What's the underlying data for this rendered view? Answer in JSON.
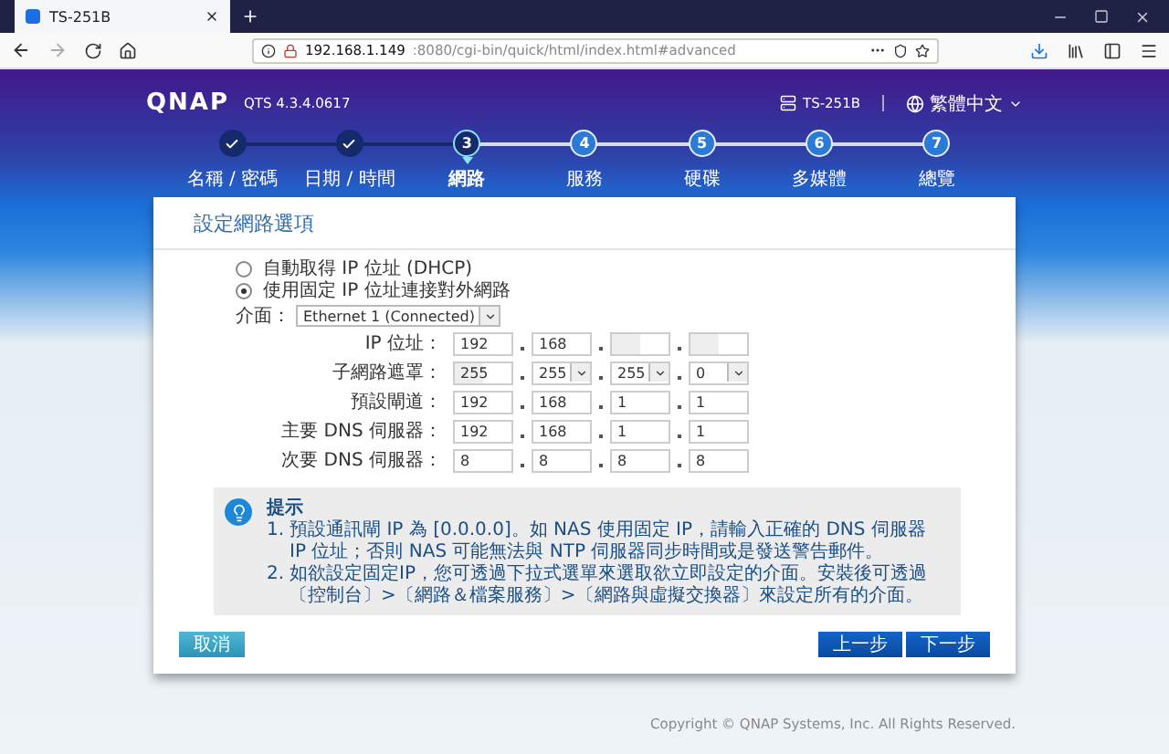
{
  "browser": {
    "tab_title": "TS-251B",
    "url_host": "192.168.1.149",
    "url_rest": ":8080/cgi-bin/quick/html/index.html#advanced"
  },
  "header": {
    "logo": "QNAP",
    "version": "QTS 4.3.4.0617",
    "model": "TS-251B",
    "language": "繁體中文"
  },
  "steps": [
    {
      "label": "名稱 / 密碼",
      "done": true,
      "selected": false
    },
    {
      "label": "日期 / 時間",
      "done": true,
      "selected": false
    },
    {
      "number": "3",
      "label": "網路",
      "done": false,
      "selected": true
    },
    {
      "number": "4",
      "label": "服務",
      "done": false,
      "selected": false
    },
    {
      "number": "5",
      "label": "硬碟",
      "done": false,
      "selected": false
    },
    {
      "number": "6",
      "label": "多媒體",
      "done": false,
      "selected": false
    },
    {
      "number": "7",
      "label": "總覽",
      "done": false,
      "selected": false
    }
  ],
  "form": {
    "title": "設定網路選項",
    "radios": [
      {
        "label": "自動取得 IP 位址 (DHCP)",
        "selected": false
      },
      {
        "label": "使用固定 IP 位址連接對外網路",
        "selected": true
      }
    ],
    "interface": {
      "label": "介面：",
      "value": "Ethernet 1 (Connected)"
    },
    "ip_rows": [
      {
        "label": "IP 位址：",
        "fields": [
          {
            "kind": "text",
            "value": "192",
            "disabled": false
          },
          {
            "kind": "text",
            "value": "168",
            "disabled": false
          },
          {
            "kind": "text",
            "disabled": true
          },
          {
            "kind": "text",
            "disabled": true
          }
        ]
      },
      {
        "label": "子網路遮罩：",
        "fields": [
          {
            "kind": "text",
            "value": "255",
            "disabled": true
          },
          {
            "kind": "select",
            "value": "255",
            "disabled": false
          },
          {
            "kind": "select",
            "value": "255",
            "disabled": false
          },
          {
            "kind": "select",
            "value": "0",
            "disabled": false
          }
        ]
      },
      {
        "label": "預設閘道：",
        "fields": [
          {
            "kind": "text",
            "value": "192",
            "disabled": false
          },
          {
            "kind": "text",
            "value": "168",
            "disabled": false
          },
          {
            "kind": "text",
            "value": "1",
            "disabled": false
          },
          {
            "kind": "text",
            "value": "1",
            "disabled": false
          }
        ]
      },
      {
        "label": "主要 DNS 伺服器：",
        "fields": [
          {
            "kind": "text",
            "value": "192",
            "disabled": false
          },
          {
            "kind": "text",
            "value": "168",
            "disabled": false
          },
          {
            "kind": "text",
            "value": "1",
            "disabled": false
          },
          {
            "kind": "text",
            "value": "1",
            "disabled": false
          }
        ]
      },
      {
        "label": "次要 DNS 伺服器：",
        "fields": [
          {
            "kind": "text",
            "value": "8",
            "disabled": false
          },
          {
            "kind": "text",
            "value": "8",
            "disabled": false
          },
          {
            "kind": "text",
            "value": "8",
            "disabled": false
          },
          {
            "kind": "text",
            "value": "8",
            "disabled": false
          }
        ]
      }
    ]
  },
  "tip": {
    "title": "提示",
    "items": [
      {
        "number": "1.",
        "text": "預設通訊閘 IP 為 [0.0.0.0]。如 NAS 使用固定 IP，請輸入正確的 DNS 伺服器 IP 位址；否則 NAS 可能無法與 NTP 伺服器同步時間或是發送警告郵件。"
      },
      {
        "number": "2.",
        "text": "如欲設定固定IP，您可透過下拉式選單來選取欲立即設定的介面。安裝後可透過〔控制台〕>〔網路＆檔案服務〕>〔網路與虛擬交換器〕來設定所有的介面。"
      }
    ]
  },
  "buttons": {
    "cancel": "取消",
    "back": "上一步",
    "next": "下一步"
  },
  "footer": {
    "copyright": "Copyright © QNAP Systems, Inc. All Rights Reserved."
  }
}
